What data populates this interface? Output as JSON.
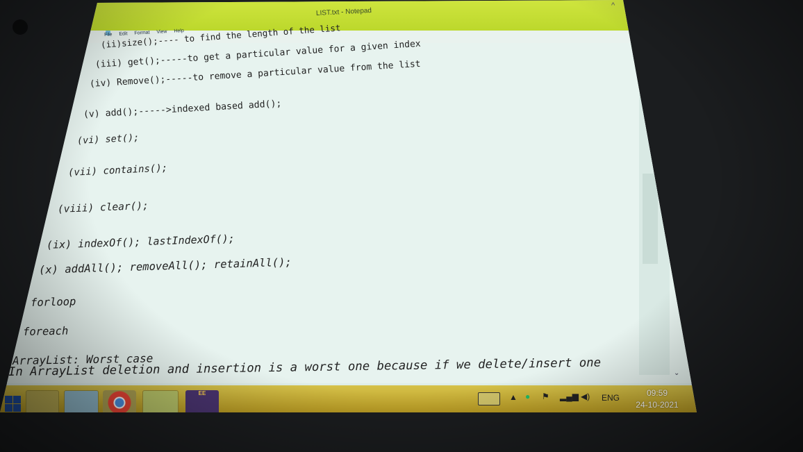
{
  "window": {
    "title": "LIST.txt - Notepad",
    "menu": [
      "File",
      "Edit",
      "Format",
      "View",
      "Help"
    ]
  },
  "editor_lines": [
    "(ii)size();---- to find the length of the list",
    "(iii) get();-----to get a particular value for a given index",
    "(iv) Remove();-----to remove a particular value from the list",
    "(v) add();----->indexed based add();",
    "(vi) set();",
    "(vii) contains();",
    "(viii) clear();",
    "(ix) indexOf(); lastIndexOf();",
    "(x) addAll(); removeAll(); retainAll();",
    "forloop",
    "foreach",
    "ArrayList: Worst case",
    "In ArrayList deletion and insertion is a worst one because if we delete/insert one"
  ],
  "taskbar": {
    "tray": {
      "language": "ENG",
      "time": "09:59",
      "date": "24-10-2021"
    },
    "icons": [
      "windows-start-icon",
      "file-explorer-icon",
      "notepad-icon",
      "chrome-icon",
      "folder-icon",
      "eclipse-java-ee-icon"
    ]
  },
  "colors": {
    "titlebar": "#c5de35",
    "editor_bg": "#e7f3ef",
    "taskbar": "#c8ad35"
  }
}
